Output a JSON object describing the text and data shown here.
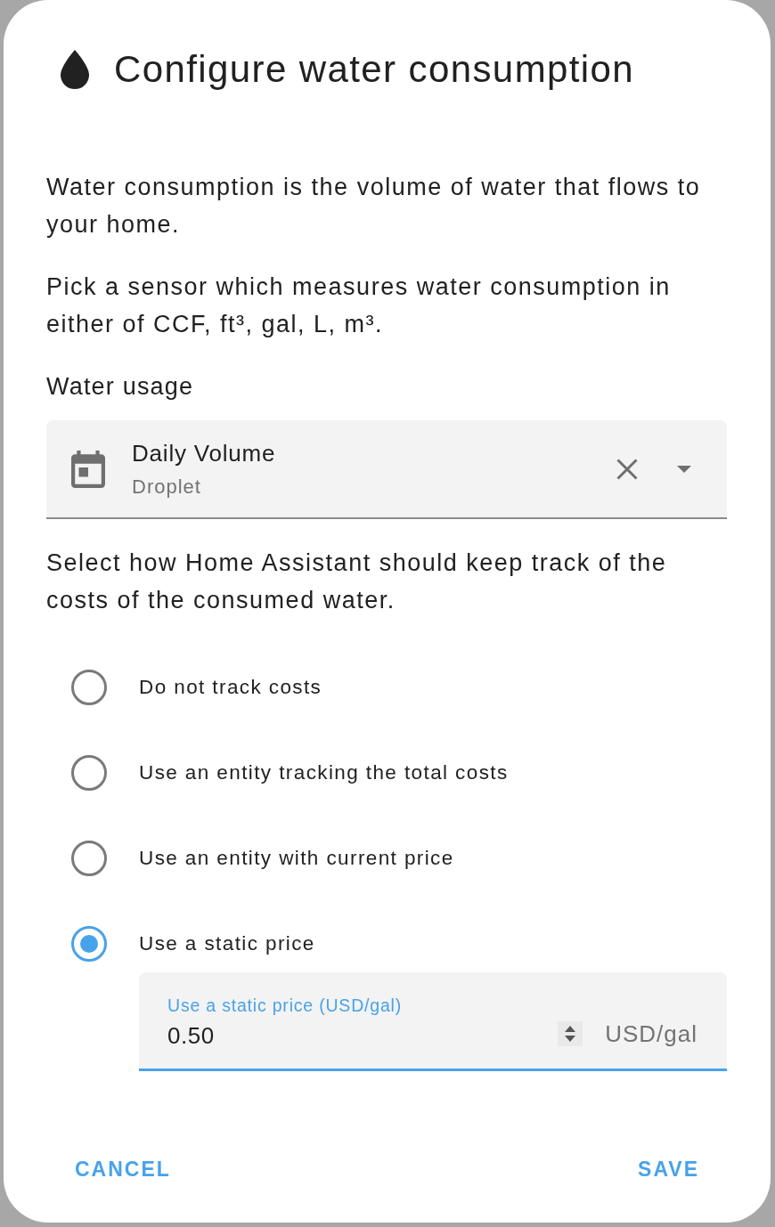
{
  "dialog": {
    "title": "Configure water consumption",
    "description": [
      "Water consumption is the volume of water that flows to your home.",
      "Pick a sensor which measures water consumption in either of CCF, ft³, gal, L, m³."
    ],
    "sensor_field": {
      "label": "Water usage",
      "value": "Daily Volume",
      "secondary": "Droplet"
    },
    "cost_prompt": "Select how Home Assistant should keep track of the costs of the consumed water.",
    "cost_options": [
      {
        "label": "Do not track costs",
        "selected": false
      },
      {
        "label": "Use an entity tracking the total costs",
        "selected": false
      },
      {
        "label": "Use an entity with current price",
        "selected": false
      },
      {
        "label": "Use a static price",
        "selected": true,
        "field": {
          "label": "Use a static price (USD/gal)",
          "value": "0.50",
          "suffix": "USD/gal"
        }
      }
    ],
    "buttons": [
      {
        "label": "CANCEL"
      },
      {
        "label": "SAVE"
      }
    ]
  }
}
